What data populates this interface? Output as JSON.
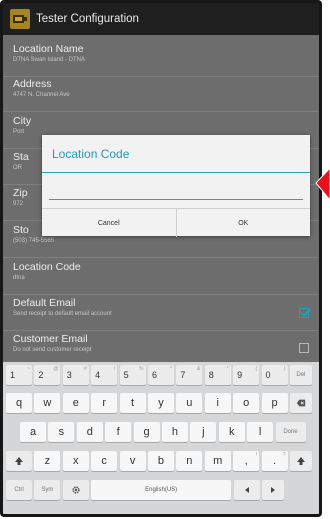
{
  "app_bar": {
    "title": "Tester Configuration",
    "icon": "app-logo-icon"
  },
  "settings": [
    {
      "title": "Location Name",
      "summary": "DTNA Swan Island - DTNA"
    },
    {
      "title": "Address",
      "summary": "4747 N. Channel Ave"
    },
    {
      "title": "City",
      "summary": "Port"
    },
    {
      "title": "Sta",
      "summary": "OR"
    },
    {
      "title": "Zip",
      "summary": "972"
    },
    {
      "title": "Sto",
      "summary": "(503) 745-5565"
    },
    {
      "title": "Location Code",
      "summary": "dtna"
    },
    {
      "title": "Default Email",
      "summary": "Send receipt to default email account",
      "checked": true
    },
    {
      "title": "Customer Email",
      "summary": "Do not send customer receipt",
      "checked": false
    }
  ],
  "dialog": {
    "title": "Location Code",
    "input_value": "",
    "cancel_label": "Cancel",
    "ok_label": "OK"
  },
  "colors": {
    "accent": "#2697ba",
    "annotation_arrow": "#e8101b",
    "dim_background": "#6d6d6d"
  },
  "keyboard": {
    "number_row": [
      {
        "label": "1",
        "sup": "~"
      },
      {
        "label": "2",
        "sup": "@"
      },
      {
        "label": "3",
        "sup": "#"
      },
      {
        "label": "4",
        "sup": "/"
      },
      {
        "label": "5",
        "sup": "%"
      },
      {
        "label": "6",
        "sup": "^"
      },
      {
        "label": "7",
        "sup": "&"
      },
      {
        "label": "8",
        "sup": "*"
      },
      {
        "label": "9",
        "sup": "("
      },
      {
        "label": "0",
        "sup": ")"
      }
    ],
    "delete_label": "Del",
    "row1": [
      "q",
      "w",
      "e",
      "r",
      "t",
      "y",
      "u",
      "i",
      "o",
      "p"
    ],
    "row2": [
      "a",
      "s",
      "d",
      "f",
      "g",
      "h",
      "j",
      "k",
      "l"
    ],
    "done_label": "Done",
    "row3": [
      "z",
      "x",
      "c",
      "v",
      "b",
      "n",
      "m",
      ",",
      "."
    ],
    "row3_sups": [
      "",
      "",
      "",
      "",
      "",
      "",
      "",
      "!",
      "?"
    ],
    "ctrl_label": "Ctrl",
    "sym_label": "Sym",
    "space_label": "English(US)"
  }
}
